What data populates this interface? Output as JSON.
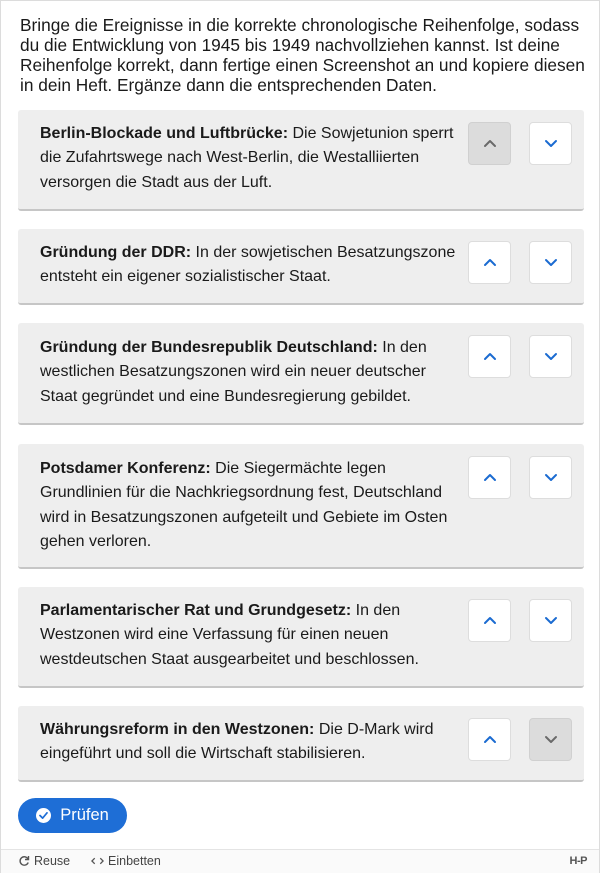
{
  "task": {
    "instructions": "Bringe die Ereignisse in die korrekte chronologische Reihenfolge, sodass du die Entwicklung von 1945 bis 1949 nachvollziehen kannst. Ist deine Reihenfolge korrekt, dann fertige einen Screenshot an und kopiere diesen in dein Heft. Ergänze dann die entsprechenden Daten."
  },
  "items": [
    {
      "title": "Berlin-Blockade und Luftbrücke:",
      "text": " Die Sowjetunion sperrt die Zufahrtswege nach West-Berlin, die Westalliierten versorgen die Stadt aus der Luft.",
      "up_disabled": true,
      "down_disabled": false
    },
    {
      "title": "Gründung der DDR:",
      "text": " In der sowjetischen Besatzungszone entsteht ein eigener sozialistischer Staat.",
      "up_disabled": false,
      "down_disabled": false
    },
    {
      "title": "Gründung der Bundesrepublik Deutschland:",
      "text": " In den westlichen Besatzungszonen wird ein neuer deutscher Staat gegründet und eine Bundesregierung gebildet.",
      "up_disabled": false,
      "down_disabled": false
    },
    {
      "title": "Potsdamer Konferenz:",
      "text": " Die Siegermächte legen Grundlinien für die Nachkriegsordnung fest, Deutschland wird in Besatzungszonen aufgeteilt und Gebiete im Osten gehen verloren.",
      "up_disabled": false,
      "down_disabled": false
    },
    {
      "title": "Parlamentarischer Rat und Grundgesetz:",
      "text": " In den Westzonen wird eine Verfassung für einen neuen westdeutschen Staat ausgearbeitet und beschlossen.",
      "up_disabled": false,
      "down_disabled": false
    },
    {
      "title": "Währungsreform in den Westzonen:",
      "text": " Die D-Mark wird eingeführt und soll die Wirtschaft stabilisieren.",
      "up_disabled": false,
      "down_disabled": true
    }
  ],
  "actions": {
    "check_label": "Prüfen"
  },
  "footer": {
    "reuse_label": "Reuse",
    "embed_label": "Einbetten",
    "logo": "H-P"
  },
  "colors": {
    "accent": "#1e6ed6",
    "item_background": "#eeeeee",
    "disabled_button": "#dcdcdc"
  },
  "icons": {
    "up": "chevron-up-icon",
    "down": "chevron-down-icon",
    "check": "check-circle-icon",
    "reuse": "refresh-icon",
    "embed": "code-icon"
  }
}
